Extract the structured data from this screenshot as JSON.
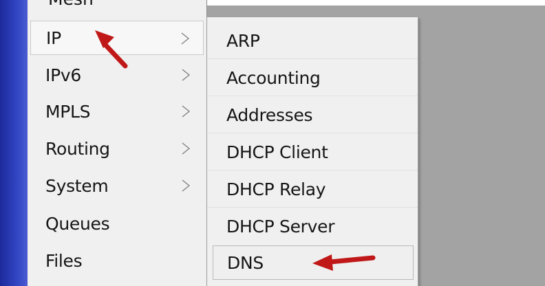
{
  "main_menu": {
    "partial_item": "Mesh",
    "items": [
      {
        "label": "IP",
        "has_submenu": true,
        "highlighted": true
      },
      {
        "label": "IPv6",
        "has_submenu": true,
        "highlighted": false
      },
      {
        "label": "MPLS",
        "has_submenu": true,
        "highlighted": false
      },
      {
        "label": "Routing",
        "has_submenu": true,
        "highlighted": false
      },
      {
        "label": "System",
        "has_submenu": true,
        "highlighted": false
      },
      {
        "label": "Queues",
        "has_submenu": false,
        "highlighted": false
      },
      {
        "label": "Files",
        "has_submenu": false,
        "highlighted": false
      }
    ]
  },
  "submenu": {
    "items": [
      {
        "label": "ARP"
      },
      {
        "label": "Accounting"
      },
      {
        "label": "Addresses"
      },
      {
        "label": "DHCP Client"
      },
      {
        "label": "DHCP Relay"
      },
      {
        "label": "DHCP Server"
      },
      {
        "label": "DNS",
        "highlighted": true
      }
    ]
  },
  "colors": {
    "annotation_arrow": "#c01818",
    "desktop_background": "#a3a3a3",
    "sidebar_strip": "#2b3cb8"
  }
}
